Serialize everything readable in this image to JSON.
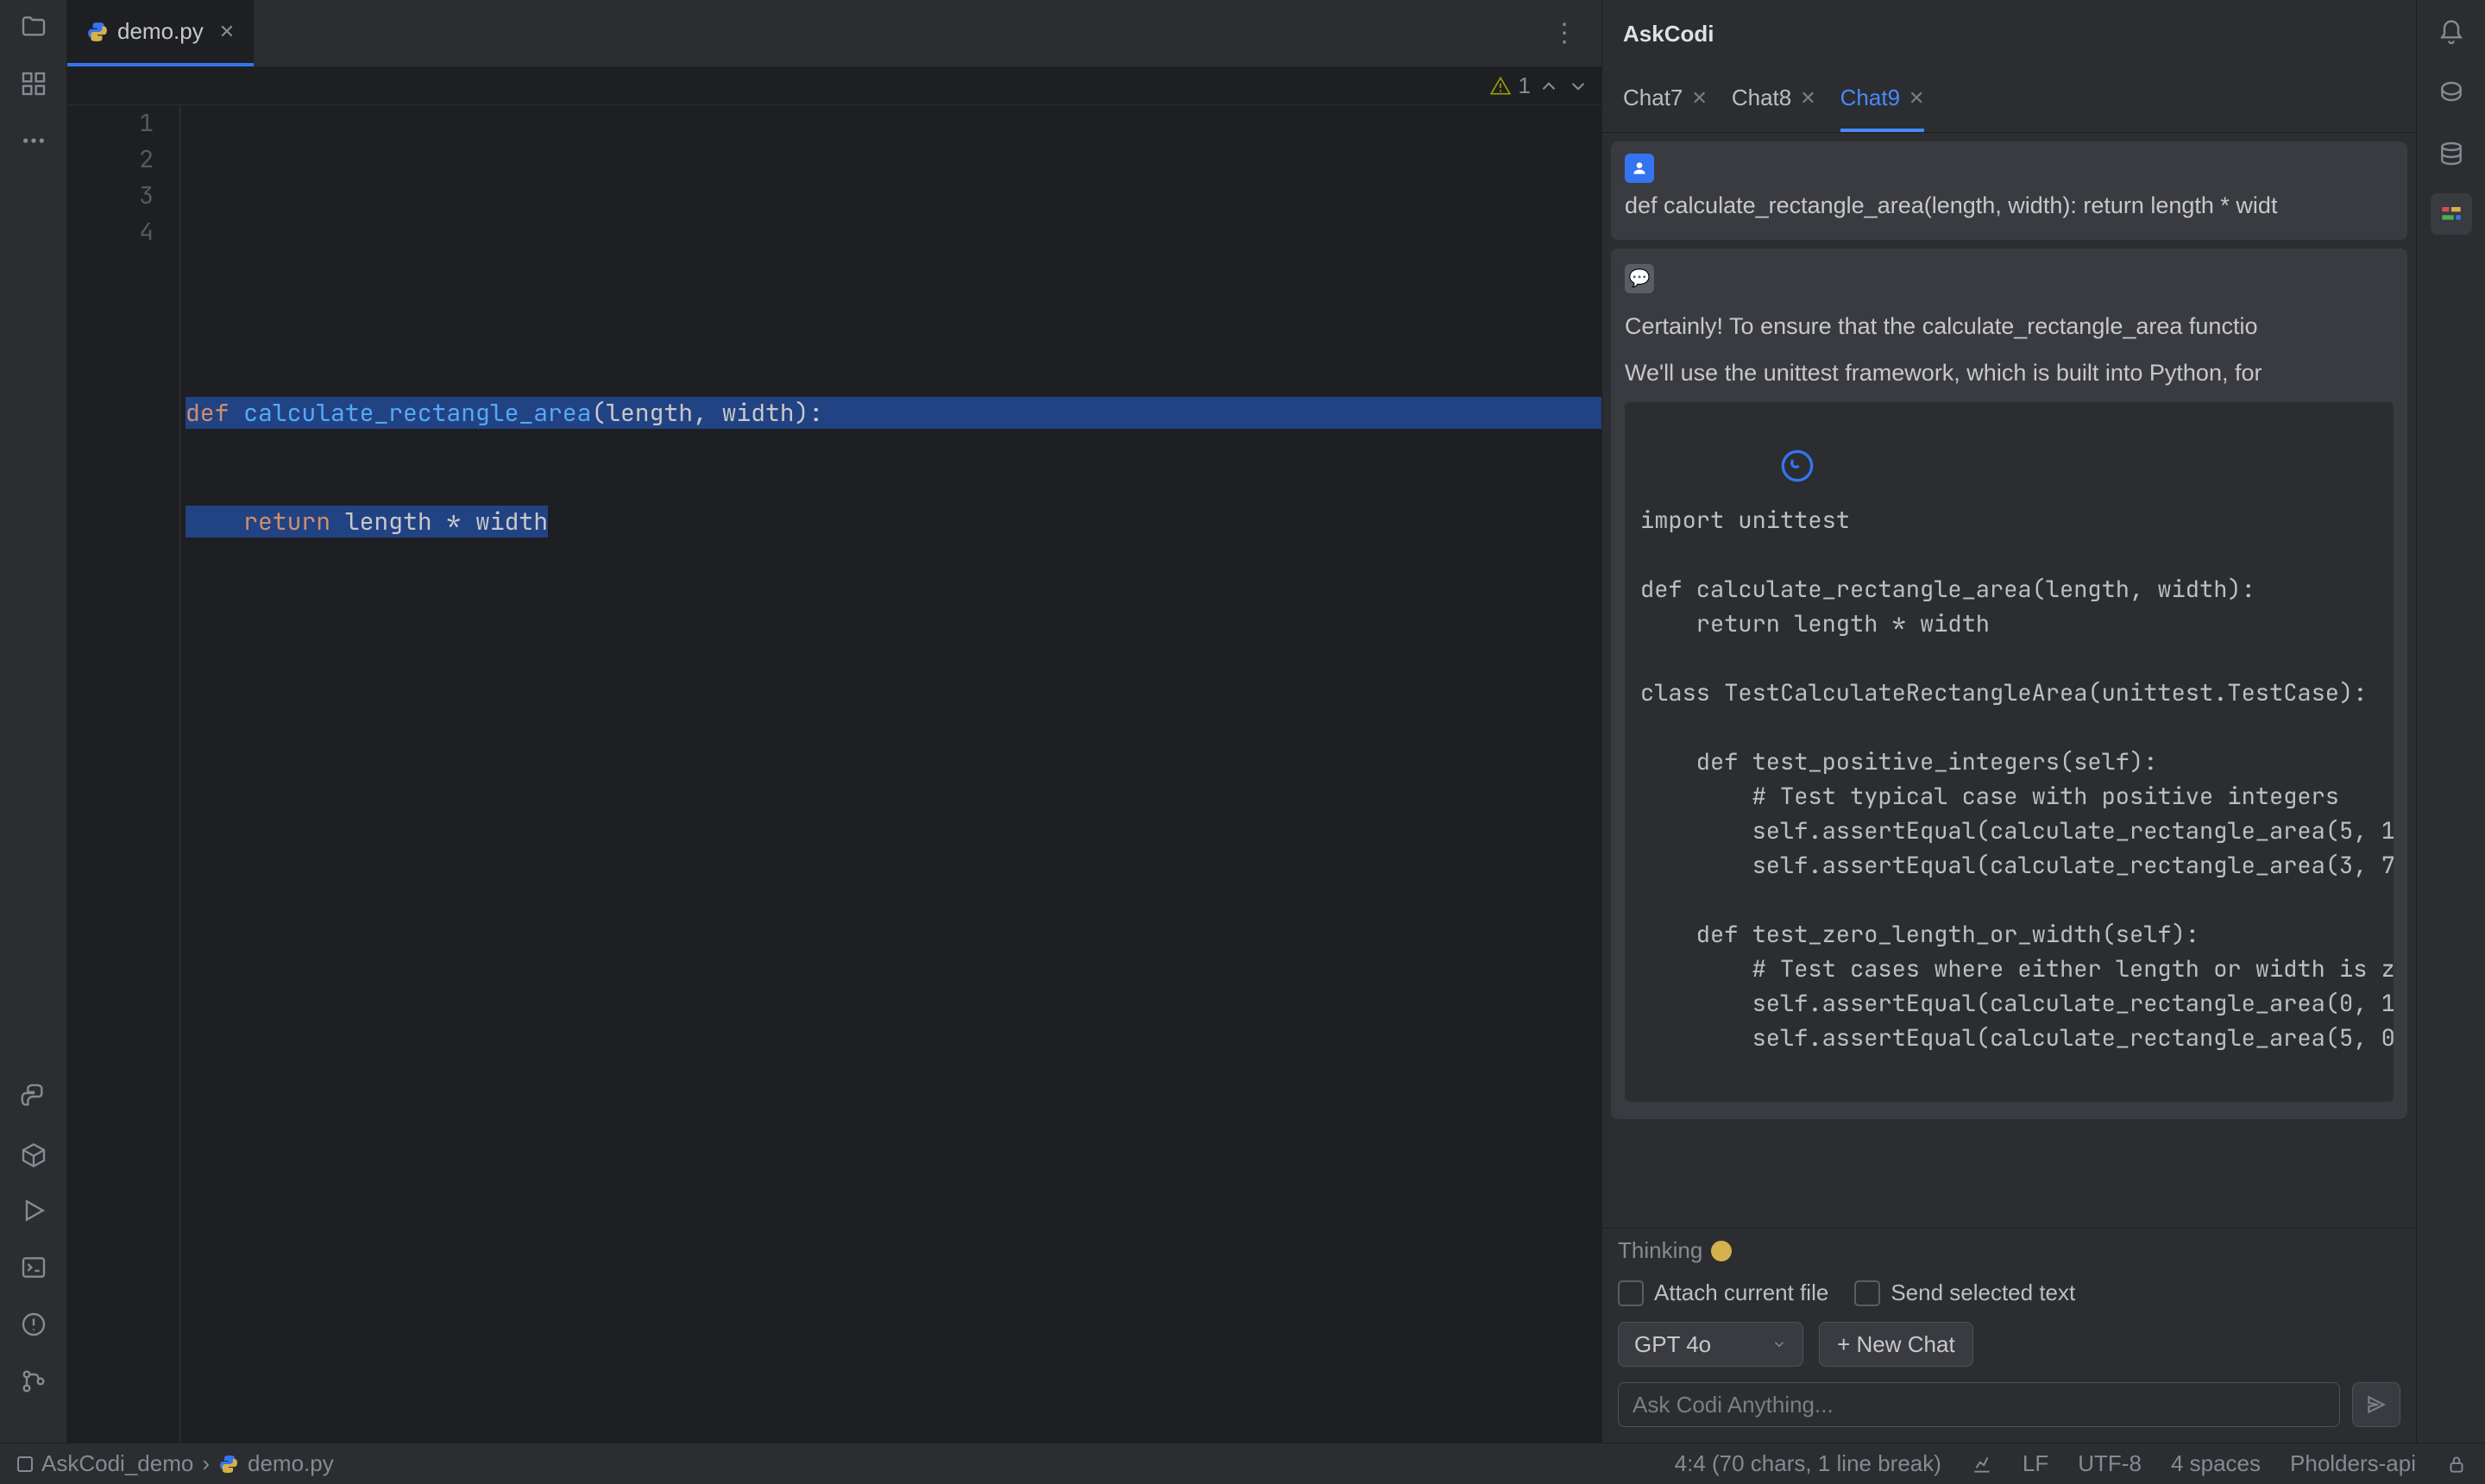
{
  "tab": {
    "filename": "demo.py"
  },
  "editor": {
    "warning_count": "1",
    "lines": {
      "1": "",
      "2": "",
      "3_kw": "def ",
      "3_fn": "calculate_rectangle_area",
      "3_rest": "(length, width):",
      "4_kw": "    return ",
      "4_rest": "length * width"
    },
    "gutter": [
      "1",
      "2",
      "3",
      "4"
    ]
  },
  "askcodi": {
    "title": "AskCodi",
    "tabs": [
      {
        "label": "Chat7"
      },
      {
        "label": "Chat8"
      },
      {
        "label": "Chat9",
        "active": true
      }
    ],
    "user_message": "def calculate_rectangle_area(length, width): return length * widt",
    "bot_para1": "Certainly! To ensure that the calculate_rectangle_area functio",
    "bot_para2": "We'll use the unittest framework, which is built into Python, for",
    "codeblock": "import unittest\n\ndef calculate_rectangle_area(length, width):\n    return length * width\n\nclass TestCalculateRectangleArea(unittest.TestCase):\n\n    def test_positive_integers(self):\n        # Test typical case with positive integers\n        self.assertEqual(calculate_rectangle_area(5, 1\n        self.assertEqual(calculate_rectangle_area(3, 7\n\n    def test_zero_length_or_width(self):\n        # Test cases where either length or width is z\n        self.assertEqual(calculate_rectangle_area(0, 1\n        self.assertEqual(calculate_rectangle_area(5, 0",
    "thinking_label": "Thinking",
    "attach_label": "Attach current file",
    "send_selected_label": "Send selected text",
    "model": "GPT 4o",
    "new_chat_label": "+ New Chat",
    "input_placeholder": "Ask Codi Anything..."
  },
  "statusbar": {
    "project": "AskCodi_demo",
    "file": "demo.py",
    "cursor": "4:4 (70 chars, 1 line break)",
    "line_sep": "LF",
    "encoding": "UTF-8",
    "indent": "4 spaces",
    "interpreter": "Pholders-api"
  }
}
